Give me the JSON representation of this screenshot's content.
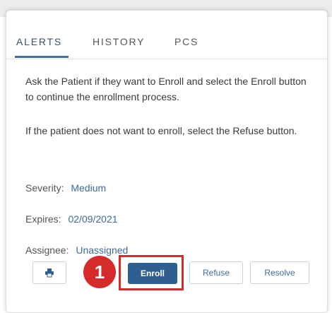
{
  "tabs": [
    {
      "label": "ALERTS",
      "active": true
    },
    {
      "label": "HISTORY",
      "active": false
    },
    {
      "label": "PCS",
      "active": false
    }
  ],
  "alert": {
    "instruction_1": "Ask the Patient if they want to Enroll and select the Enroll button to continue the enrollment process.",
    "instruction_2": "If the patient does not want to enroll, select the Refuse button.",
    "severity_label": "Severity:",
    "severity_value": "Medium",
    "expires_label": "Expires:",
    "expires_value": "02/09/2021",
    "assignee_label": "Assignee:",
    "assignee_value": "Unassigned"
  },
  "actions": {
    "print_icon": "print-icon",
    "enroll_label": "Enroll",
    "refuse_label": "Refuse",
    "resolve_label": "Resolve"
  },
  "annotation": {
    "step_number": "1"
  },
  "colors": {
    "primary": "#2f5f91",
    "link": "#3d6b9a",
    "annotation_red": "#d62b2b",
    "tab_underline": "#3f6f9d"
  }
}
